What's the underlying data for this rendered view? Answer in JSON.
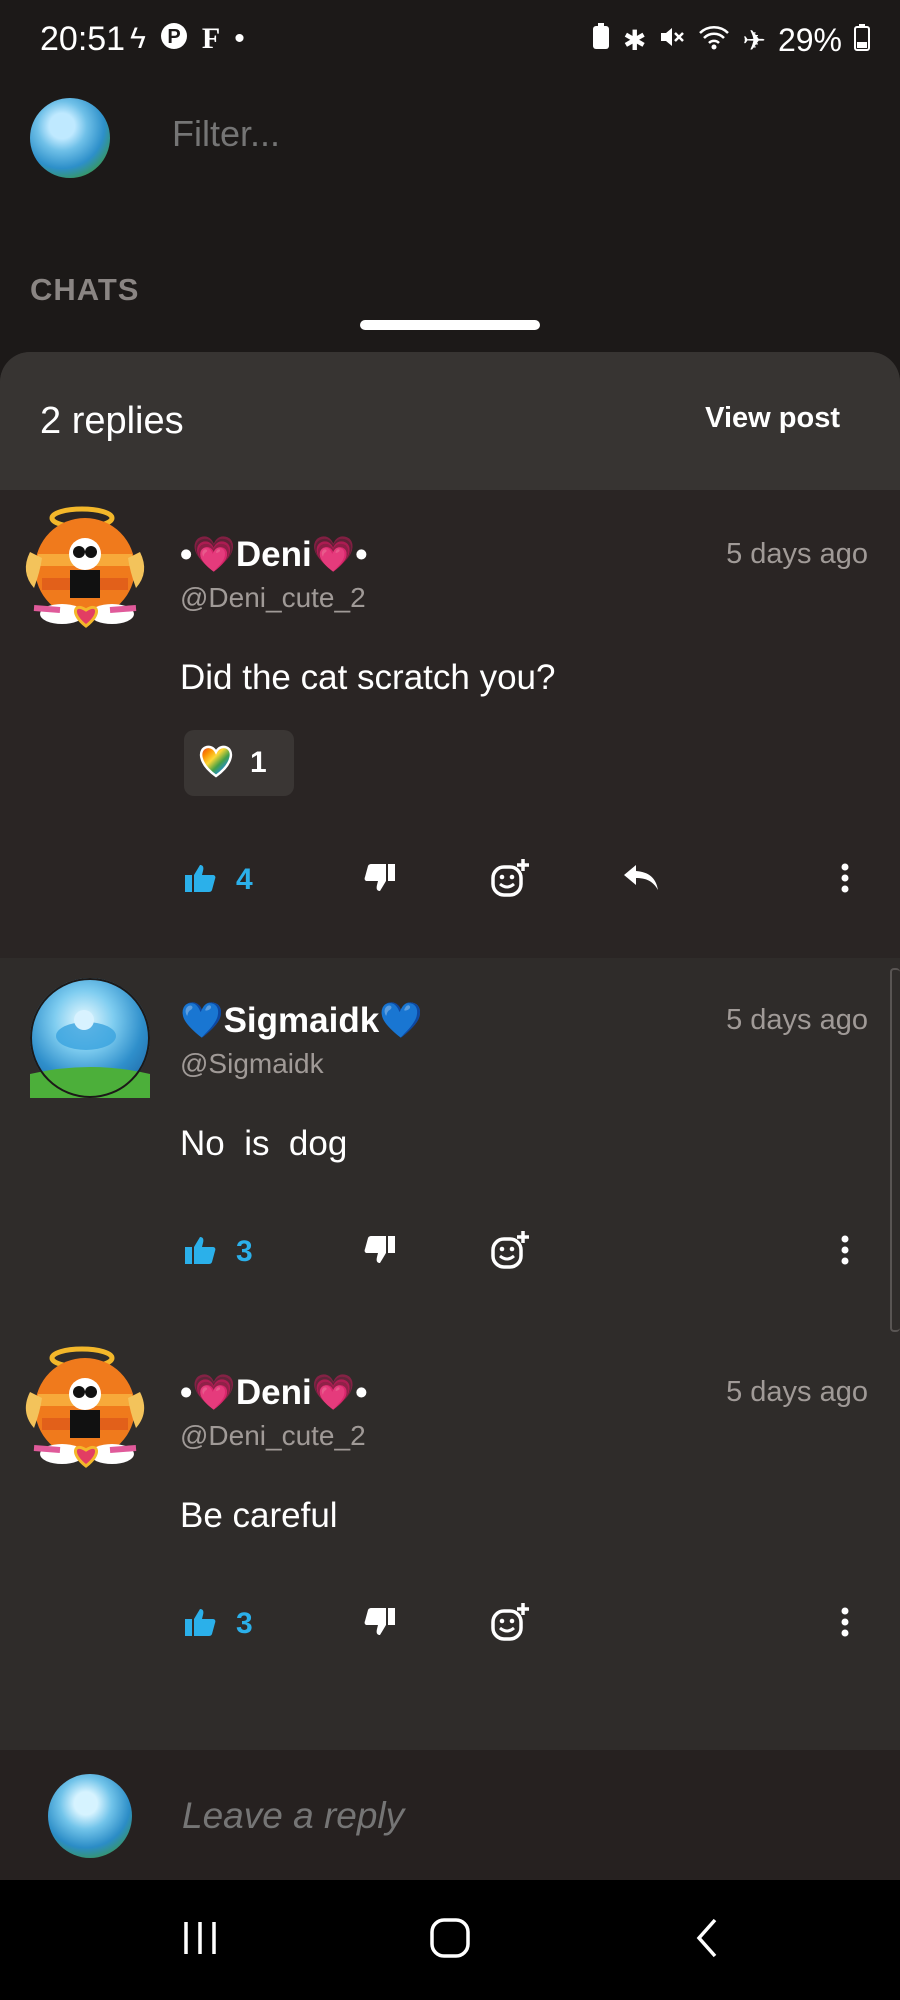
{
  "status_bar": {
    "time": "20:51",
    "battery": "29%",
    "left_icons": [
      "flash-icon",
      "pinterest-icon",
      "f-icon",
      "dot-icon"
    ],
    "right_icons": [
      "battery-saver-icon",
      "bluetooth-icon",
      "mute-icon",
      "wifi-icon",
      "airplane-icon"
    ]
  },
  "filter": {
    "placeholder": "Filter..."
  },
  "section_label": "CHATS",
  "sheet": {
    "replies_label": "2 replies",
    "view_post_label": "View post"
  },
  "comments": [
    {
      "username": "•💗Deni💗•",
      "handle": "@Deni_cute_2",
      "time": "5 days ago",
      "text": "Did the cat scratch you?",
      "reaction": {
        "icon": "rainbow-heart-icon",
        "count": "1"
      },
      "likes": "4",
      "has_reply_button": true
    },
    {
      "username": "💙Sigmaidk💙",
      "handle": "@Sigmaidk",
      "time": "5 days ago",
      "text": "No  is  dog",
      "likes": "3",
      "has_reply_button": false
    },
    {
      "username": "•💗Deni💗•",
      "handle": "@Deni_cute_2",
      "time": "5 days ago",
      "text": "Be careful",
      "likes": "3",
      "has_reply_button": false
    }
  ],
  "reply_bar": {
    "placeholder": "Leave a reply"
  },
  "colors": {
    "accent": "#2bb0ea",
    "background": "#1c1918",
    "sheet": "#2f2c2a"
  }
}
